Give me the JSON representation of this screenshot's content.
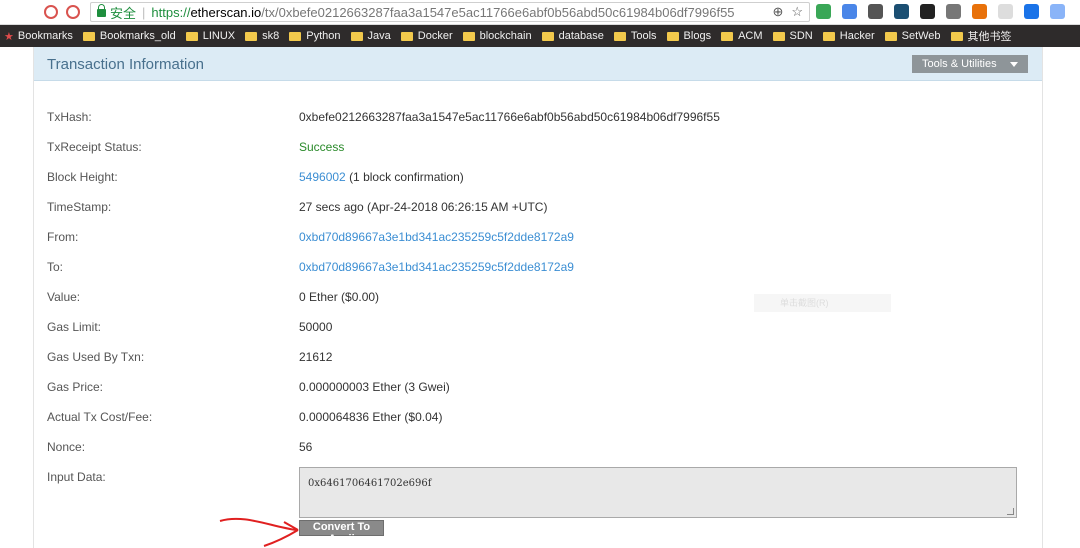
{
  "browser": {
    "secure_label": "安全",
    "url_scheme": "https://",
    "url_host": "etherscan.io",
    "url_path": "/tx/0xbefe0212663287faa3a1547e5ac11766e6abf0b56abd50c61984b06df7996f55",
    "zoom_icon": "⊕",
    "star_icon": "☆",
    "extensions": [
      {
        "name": "ext-green-icon",
        "color": "#3aa757"
      },
      {
        "name": "ext-translate-icon",
        "color": "#4a86e8"
      },
      {
        "name": "ext-owl-icon",
        "color": "#555555"
      },
      {
        "name": "ext-s-icon",
        "color": "#1b4f72"
      },
      {
        "name": "ext-h-icon",
        "color": "#222222"
      },
      {
        "name": "ext-gear-icon",
        "color": "#777777"
      },
      {
        "name": "ext-fire-icon",
        "color": "#e8710a"
      },
      {
        "name": "ext-white-icon",
        "color": "#dddddd"
      },
      {
        "name": "ext-blue-icon",
        "color": "#1a73e8"
      },
      {
        "name": "ext-puzzle-icon",
        "color": "#8ab4f8"
      }
    ]
  },
  "bookmarks": [
    "Bookmarks",
    "Bookmarks_old",
    "LINUX",
    "sk8",
    "Python",
    "Java",
    "Docker",
    "blockchain",
    "database",
    "Tools",
    "Blogs",
    "ACM",
    "SDN",
    "Hacker",
    "SetWeb",
    "其他书签"
  ],
  "panel": {
    "title": "Transaction Information",
    "tools_label": "Tools & Utilities"
  },
  "tx": {
    "hash_label": "TxHash:",
    "hash": "0xbefe0212663287faa3a1547e5ac11766e6abf0b56abd50c61984b06df7996f55",
    "status_label": "TxReceipt Status:",
    "status": "Success",
    "block_label": "Block Height:",
    "block": "5496002",
    "block_conf": "(1 block confirmation)",
    "time_label": "TimeStamp:",
    "time": "27 secs ago (Apr-24-2018 06:26:15 AM +UTC)",
    "from_label": "From:",
    "from": "0xbd70d89667a3e1bd341ac235259c5f2dde8172a9",
    "to_label": "To:",
    "to": "0xbd70d89667a3e1bd341ac235259c5f2dde8172a9",
    "value_label": "Value:",
    "value": "0 Ether ($0.00)",
    "gas_limit_label": "Gas Limit:",
    "gas_limit": "50000",
    "gas_used_label": "Gas Used By Txn:",
    "gas_used": "21612",
    "gas_price_label": "Gas Price:",
    "gas_price": "0.000000003 Ether (3 Gwei)",
    "fee_label": "Actual Tx Cost/Fee:",
    "fee": "0.000064836 Ether ($0.04)",
    "nonce_label": "Nonce:",
    "nonce": "56",
    "input_label": "Input Data:",
    "input": "0x6461706461702e696f",
    "convert_label": "Convert To Ascii"
  },
  "ghost_tooltip": "单击截图(R)"
}
